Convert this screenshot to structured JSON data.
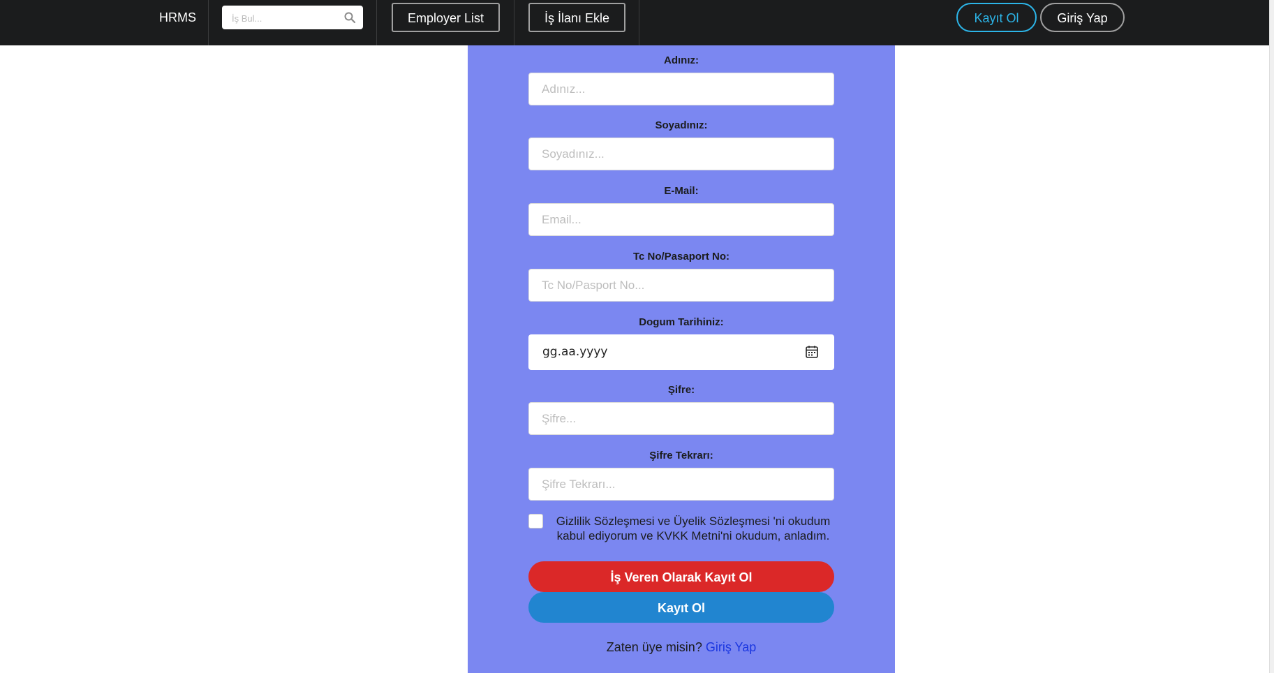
{
  "nav": {
    "brand": "HRMS",
    "search_placeholder": "İş Bul...",
    "employer_list": "Employer List",
    "add_job": "İş İlanı Ekle",
    "register": "Kayıt Ol",
    "login": "Giriş Yap"
  },
  "form": {
    "fields": [
      {
        "label": "Adınız:",
        "placeholder": "Adınız..."
      },
      {
        "label": "Soyadınız:",
        "placeholder": "Soyadınız..."
      },
      {
        "label": "E-Mail:",
        "placeholder": "Email..."
      },
      {
        "label": "Tc No/Pasaport No:",
        "placeholder": "Tc No/Pasport No..."
      },
      {
        "label": "Dogum Tarihiniz:",
        "placeholder": "gg.aa.yyyy"
      },
      {
        "label": "Şifre:",
        "placeholder": "Şifre..."
      },
      {
        "label": "Şifre Tekrarı:",
        "placeholder": "Şifre Tekrarı..."
      }
    ],
    "consent_line1": "Gizlilik Sözleşmesi ve Üyelik Sözleşmesi 'ni okudum",
    "consent_line2": "kabul ediyorum ve KVKK Metni'ni okudum, anladım.",
    "employer_register": "İş Veren Olarak Kayıt Ol",
    "register": "Kayıt Ol",
    "footer_text": "Zaten üye misin?",
    "footer_link": "Giriş Yap"
  },
  "colors": {
    "navbar": "#1b1c1d",
    "panel": "#7b87f1",
    "employer_button": "#db2828",
    "register_button": "#2185d0",
    "register_nav_border": "#2cb5e8",
    "link": "#1a36e0"
  },
  "icons": {
    "search": "search-icon",
    "calendar": "calendar-icon"
  }
}
